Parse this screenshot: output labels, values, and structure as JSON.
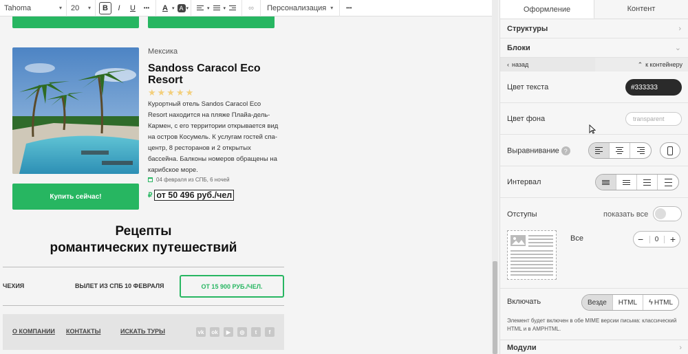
{
  "toolbar": {
    "font": "Tahoma",
    "size": "20",
    "bold": "B",
    "italic": "I",
    "underline": "U",
    "more": "•••",
    "text_color": "A",
    "bg_color": "A",
    "personalization": "Персонализация",
    "more2": "•••"
  },
  "email": {
    "country": "Мексика",
    "hotel_name": "Sandoss Caracol Eco Resort",
    "stars": "★★★★★",
    "description": "Курортный отель Sandos Caracol Eco Resort находится на пляже Плайа-дель-Кармен, с его территории открывается вид на остров Косумель. К услугам гостей спа-центр, 8 ресторанов и 2 открытых бассейна. Балконы номеров обращены на карибское море.",
    "buy_button": "Купить сейчас!",
    "dates": "04 февраля из СПБ, 6 ночей",
    "ruble": "₽",
    "price": "от 50 496 руб./чел",
    "recipes_title_1": "Рецепты",
    "recipes_title_2": "романтических путешествий",
    "row": {
      "country": "ЧЕХИЯ",
      "departure": "ВЫЛЕТ ИЗ СПБ 10 ФЕВРАЛЯ",
      "price_button": "ОТ 15 900 РУБ./ЧЕЛ."
    },
    "footer": {
      "about": "О КОМПАНИИ",
      "contacts": "КОНТАКТЫ",
      "search": "ИСКАТЬ ТУРЫ"
    },
    "socials": [
      "vk",
      "ok",
      "▶",
      "◎",
      "t",
      "f"
    ]
  },
  "panel": {
    "tab_design": "Оформление",
    "tab_content": "Контент",
    "structures": "Структуры",
    "blocks": "Блоки",
    "back": "назад",
    "to_container": "к контейнеру",
    "text_color_label": "Цвет текста",
    "text_color_value": "#333333",
    "bg_color_label": "Цвет фона",
    "bg_color_value": "transparent",
    "align_label": "Выравнивание",
    "interval_label": "Интервал",
    "padding_label": "Отступы",
    "show_all": "показать все",
    "all_label": "Все",
    "padding_value": "0",
    "include_label": "Включать",
    "include_everywhere": "Везде",
    "include_html": "HTML",
    "include_amphtml": "HTML",
    "hint": "Элемент будет включен в обе MIME версии письма: классический HTML и в AMPHTML.",
    "modules": "Модули"
  },
  "colors": {
    "green": "#27b661",
    "dark": "#2a2a2a"
  }
}
